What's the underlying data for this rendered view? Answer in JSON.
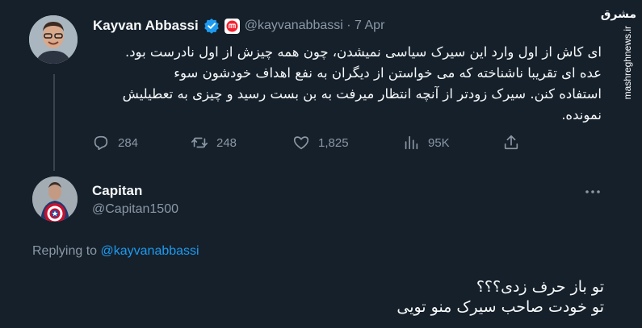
{
  "tweet": {
    "author_name": "Kayvan Abbassi",
    "handle": "@kayvanabbassi",
    "separator": "·",
    "date": "7 Apr",
    "text_lines": [
      "ای کاش از اول وارد این سیرک سیاسی نمیشدن، چون همه چیزش از اول نادرست بود.",
      "عده ای تقریبا ناشناخته که می خواستن از دیگران به نفع اهداف خودشون سوء",
      "استفاده کنن. سیرک زودتر از آنچه انتظار میرفت به بن بست رسید و چیزی به تعطیلیش",
      "نمونده."
    ],
    "stats": {
      "replies": "284",
      "retweets": "248",
      "likes": "1,825",
      "views": "95K"
    }
  },
  "reply": {
    "author_name": "Capitan",
    "handle": "@Capitan1500",
    "replying_prefix": "Replying to",
    "replying_handle": "@kayvanabbassi",
    "text_lines": [
      "تو باز حرف زدی؟؟؟",
      "تو خودت صاحب سیرک منو تویی"
    ]
  },
  "watermark": {
    "logo_text": "مشرق",
    "site_text": "mashreghnews.ir"
  },
  "colors": {
    "background": "#15202b",
    "text": "#f7f9f9",
    "muted": "#8b98a5",
    "accent": "#1d9bf0",
    "verified_badge": "#1d9bf0",
    "affiliate_badge": "#f4212e"
  },
  "icons": [
    "verified-badge-icon",
    "affiliate-badge-icon",
    "reply-icon",
    "retweet-icon",
    "like-icon",
    "views-icon",
    "share-icon",
    "more-icon"
  ]
}
